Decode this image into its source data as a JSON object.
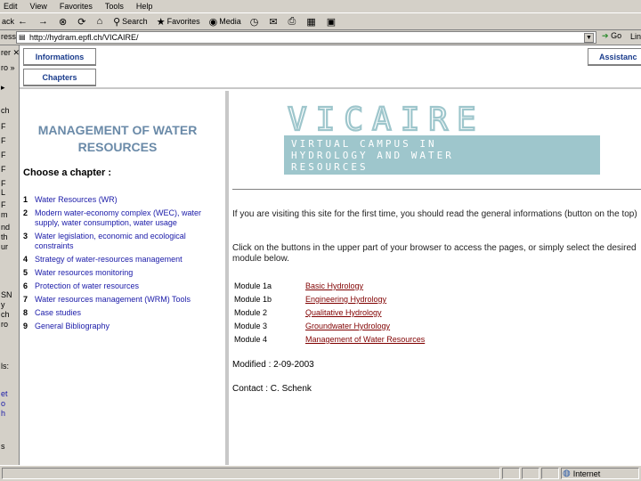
{
  "menu": [
    "Edit",
    "View",
    "Favorites",
    "Tools",
    "Help"
  ],
  "toolbar": {
    "back": "ack",
    "back_arrow": "←",
    "forward_arrow": "→",
    "search": "Search",
    "favorites": "Favorites",
    "media": "Media"
  },
  "address": {
    "label": "ress",
    "url": "http://hydram.epfl.ch/VICAIRE/",
    "go": "Go",
    "links": "Lin"
  },
  "explorer": {
    "rows": [
      "rer ✕",
      "ro »",
      "▸",
      "ch",
      "F",
      "F",
      "F",
      "F",
      "F",
      "L",
      "F",
      "m",
      "nd",
      "th",
      "ur",
      "SN",
      "y",
      "ch",
      "ro",
      "ls:",
      "et",
      "o",
      "h",
      "s"
    ]
  },
  "top_frame": {
    "tab_informations": "Informations",
    "tab_chapters": "Chapters",
    "tab_assistance": "Assistanc"
  },
  "left": {
    "title": "MANAGEMENT OF WATER RESOURCES",
    "choose": "Choose a chapter :",
    "chapters": [
      {
        "num": "1",
        "text": "Water Resources (WR)"
      },
      {
        "num": "2",
        "text": "Modern water-economy complex (WEC), water supply, water consumption, water usage"
      },
      {
        "num": "3",
        "text": "Water legislation, economic and ecological constraints"
      },
      {
        "num": "4",
        "text": "Strategy of water-resources management"
      },
      {
        "num": "5",
        "text": "Water resources monitoring"
      },
      {
        "num": "6",
        "text": "Protection of water resources"
      },
      {
        "num": "7",
        "text": "Water resources management (WRM) Tools"
      },
      {
        "num": "8",
        "text": "Case studies"
      },
      {
        "num": "9",
        "text": "General Bibliography"
      }
    ]
  },
  "right": {
    "logo_word": "VICAIRE",
    "logo_lines": [
      "VIRTUAL CAMPUS IN",
      "HYDROLOGY AND WATER",
      "RESOURCES"
    ],
    "intro": "If you are visiting this site for the first time, you should read the general informations (button on the top)",
    "click": "Click on the buttons in the upper part of your browser to access the pages, or simply select the desired module below.",
    "modules": [
      {
        "name": "Module 1a",
        "link": "Basic Hydrology"
      },
      {
        "name": "Module 1b",
        "link": "Engineering Hydrology"
      },
      {
        "name": "Module 2",
        "link": "Qualitative Hydrology"
      },
      {
        "name": "Module 3",
        "link": "Groundwater Hydrology"
      },
      {
        "name": "Module 4",
        "link": "Management of Water Resources"
      }
    ],
    "modified": "Modified : 2-09-2003",
    "contact": "Contact : C. Schenk"
  },
  "status": {
    "zone": "Internet"
  },
  "colors": {
    "chrome": "#d4d0c8",
    "logo_teal": "#9ec6cc",
    "title_blue": "#6a8aa8",
    "link_maroon": "#800000",
    "chapter_blue": "#1a1aa8"
  }
}
